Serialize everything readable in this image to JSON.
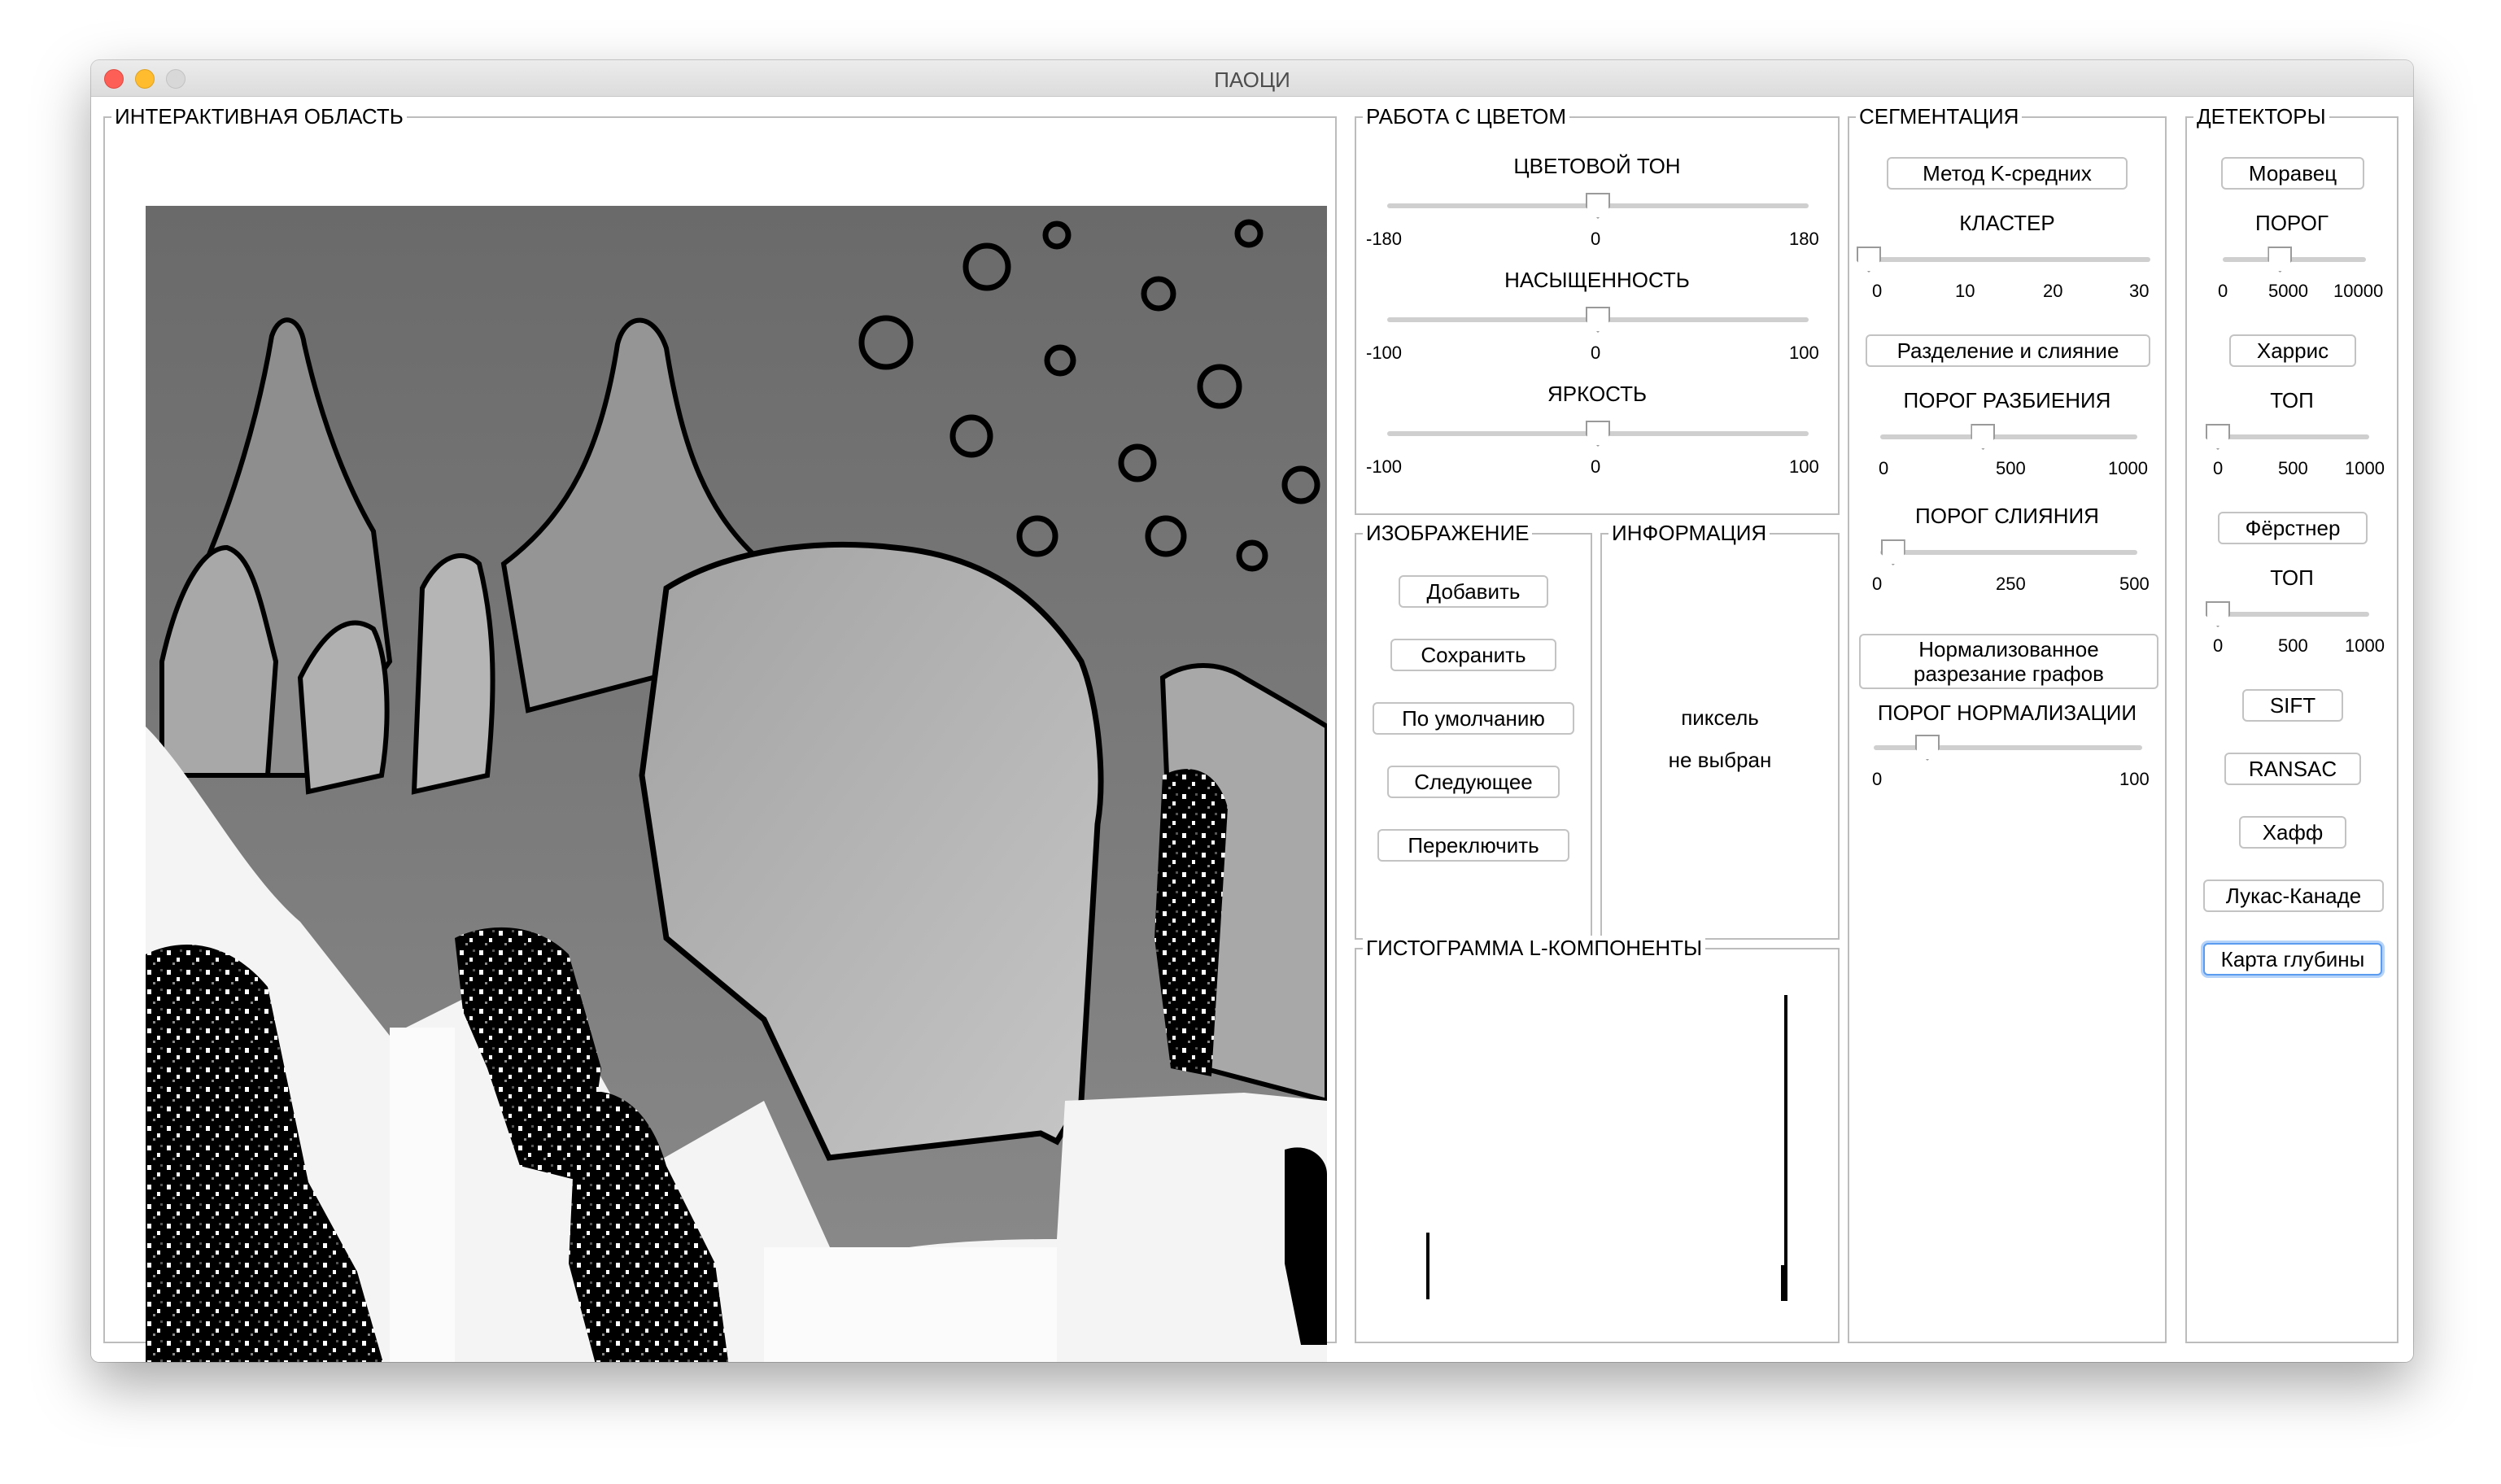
{
  "window": {
    "title": "ПАОЦИ"
  },
  "interactive": {
    "title": "ИНТЕРАКТИВНАЯ ОБЛАСТЬ"
  },
  "color": {
    "title": "РАБОТА С ЦВЕТОМ",
    "hue": {
      "label": "ЦВЕТОВОЙ ТОН",
      "min": "-180",
      "mid": "0",
      "max": "180",
      "value": 0
    },
    "saturation": {
      "label": "НАСЫЩЕННОСТЬ",
      "min": "-100",
      "mid": "0",
      "max": "100",
      "value": 0
    },
    "brightness": {
      "label": "ЯРКОСТЬ",
      "min": "-100",
      "mid": "0",
      "max": "100",
      "value": 0
    }
  },
  "image": {
    "title": "ИЗОБРАЖЕНИЕ",
    "add": "Добавить",
    "save": "Сохранить",
    "default": "По умолчанию",
    "next": "Следующее",
    "toggle": "Переключить"
  },
  "info": {
    "title": "ИНФОРМАЦИЯ",
    "line1": "пиксель",
    "line2": "не выбран"
  },
  "histogram": {
    "title": "ГИСТОГРАММА L-КОМПОНЕНТЫ"
  },
  "segmentation": {
    "title": "СЕГМЕНТАЦИЯ",
    "kmeans": "Метод K-средних",
    "cluster": {
      "label": "КЛАСТЕР",
      "ticks": [
        "0",
        "10",
        "20",
        "30"
      ],
      "value": 0
    },
    "split_merge": "Разделение и слияние",
    "split_threshold": {
      "label": "ПОРОГ РАЗБИЕНИЯ",
      "ticks": [
        "0",
        "500",
        "1000"
      ],
      "value": 400
    },
    "merge_threshold": {
      "label": "ПОРОГ СЛИЯНИЯ",
      "ticks": [
        "0",
        "250",
        "500"
      ],
      "value": 25
    },
    "normcut_line1": "Нормализованное",
    "normcut_line2": "разрезание графов",
    "norm_threshold": {
      "label": "ПОРОГ НОРМАЛИЗАЦИИ",
      "ticks": [
        "0",
        "100"
      ],
      "value": 20
    }
  },
  "detectors": {
    "title": "ДЕТЕКТОРЫ",
    "moravec": "Моравец",
    "threshold": {
      "label": "ПОРОГ",
      "ticks": [
        "0",
        "5000",
        "10000"
      ],
      "value": 4000
    },
    "harris": "Харрис",
    "top1": {
      "label": "ТОП",
      "ticks": [
        "0",
        "500",
        "1000"
      ],
      "value": 0
    },
    "forstner": "Фёрстнер",
    "top2": {
      "label": "ТОП",
      "ticks": [
        "0",
        "500",
        "1000"
      ],
      "value": 0
    },
    "sift": "SIFT",
    "ransac": "RANSAC",
    "hough": "Хафф",
    "lucas_kanade": "Лукас-Канаде",
    "depth_map": "Карта глубины"
  }
}
